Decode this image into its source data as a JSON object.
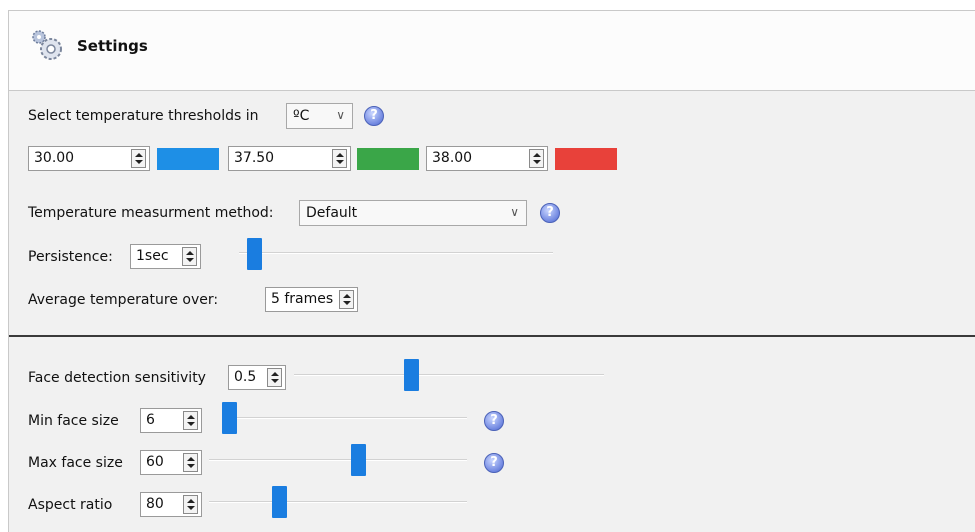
{
  "header": {
    "title": "Settings",
    "icon": "gear-icon"
  },
  "thresholds": {
    "label": "Select temperature thresholds in",
    "unit": "ºC",
    "low": {
      "value": "30.00",
      "color": "#1e8fe6"
    },
    "mid": {
      "value": "37.50",
      "color": "#3aa648"
    },
    "high": {
      "value": "38.00",
      "color": "#e8413a"
    }
  },
  "method": {
    "label": "Temperature measurment method:",
    "value": "Default"
  },
  "persistence": {
    "label": "Persistence:",
    "value": "1sec",
    "level": 0.04
  },
  "average": {
    "label": "Average temperature over:",
    "value": "5 frames"
  },
  "face_sensitivity": {
    "label": "Face detection sensitivity",
    "value": "0.5",
    "level": 0.5
  },
  "min_face": {
    "label": "Min face size",
    "value": "6",
    "level": 0.0
  },
  "max_face": {
    "label": "Max face size",
    "value": "60",
    "level": 0.55
  },
  "aspect": {
    "label": "Aspect ratio",
    "value": "80",
    "level": 0.33
  },
  "help_glyph": "?"
}
